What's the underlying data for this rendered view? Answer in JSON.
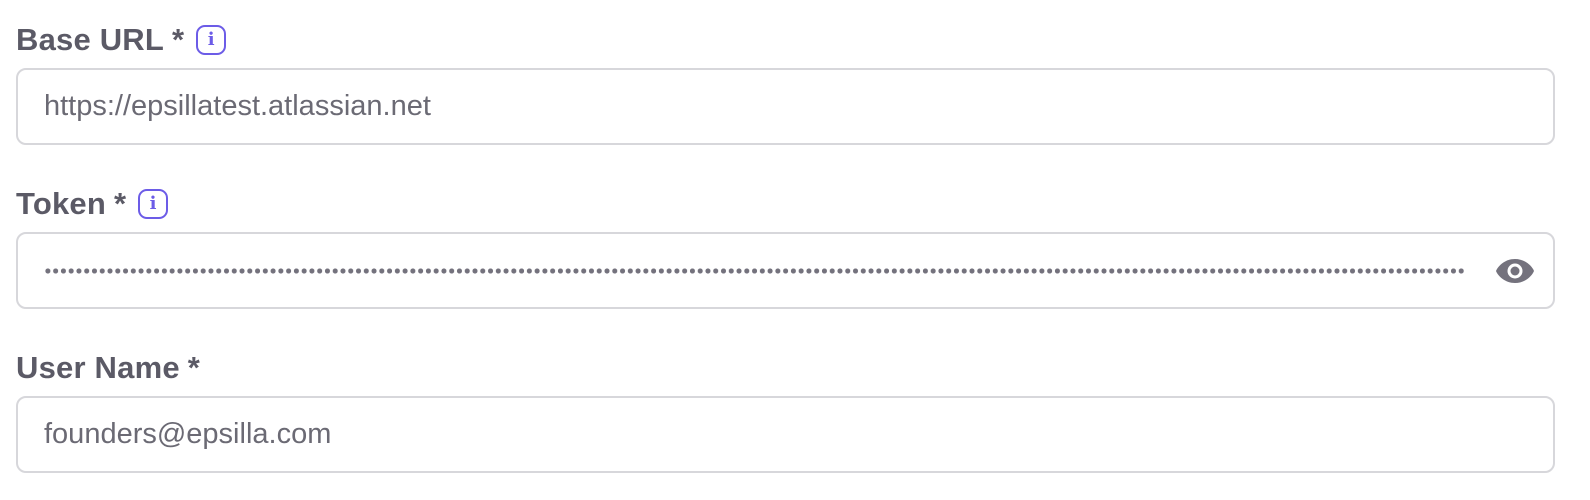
{
  "form": {
    "base_url": {
      "label": "Base URL",
      "required_mark": "*",
      "info_icon": "info-icon",
      "value": "https://epsillatest.atlassian.net"
    },
    "token": {
      "label": "Token",
      "required_mark": "*",
      "info_icon": "info-icon",
      "masked": true,
      "toggle_icon": "eye-icon"
    },
    "user_name": {
      "label": "User Name",
      "required_mark": "*",
      "value": "founders@epsilla.com"
    }
  },
  "colors": {
    "label": "#5b5a66",
    "input_text": "#6b6a74",
    "border": "#d7d7db",
    "accent": "#6c5ce7",
    "icon": "#74727d"
  }
}
